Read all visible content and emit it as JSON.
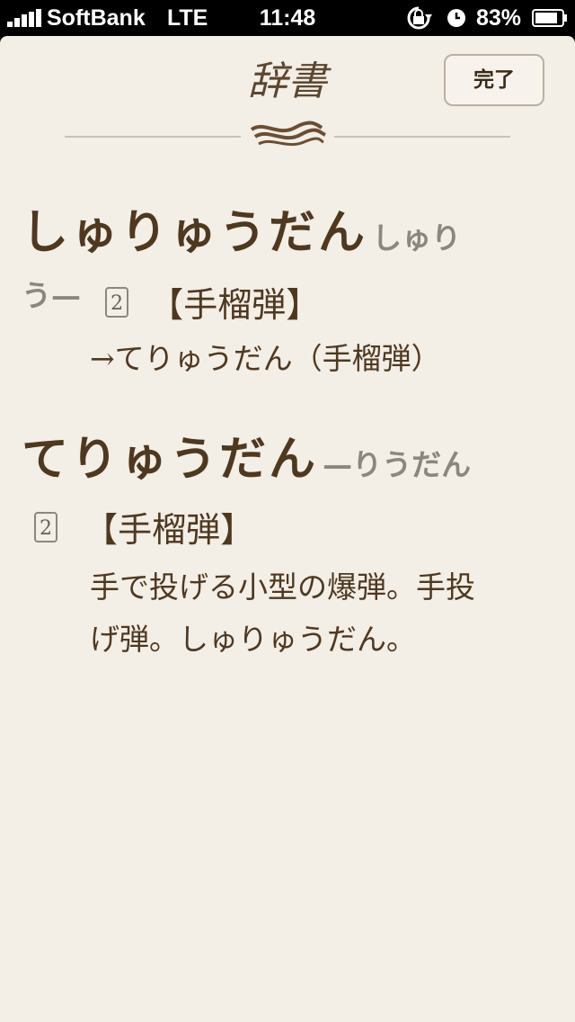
{
  "status_bar": {
    "carrier": "SoftBank",
    "network": "LTE",
    "time": "11:48",
    "battery": "83%"
  },
  "nav": {
    "title": "辞書",
    "done_label": "完了"
  },
  "entries": [
    {
      "headword": "しゅりゅうだん",
      "reading_part1": "しゅり",
      "reading_part2": "う—",
      "num": "2",
      "kanji": "【手榴弾】",
      "definition_lines": [
        "→てりゅうだん（手榴弾）"
      ]
    },
    {
      "headword": "てりゅうだん",
      "reading": "—りうだん",
      "num": "2",
      "kanji": "【手榴弾】",
      "definition_lines": [
        "手で投げる小型の爆弾。手投",
        "げ弾。しゅりゅうだん。"
      ]
    }
  ],
  "colors": {
    "background": "#f3eee6",
    "headword": "#4f3820",
    "reading": "#8c8680"
  }
}
